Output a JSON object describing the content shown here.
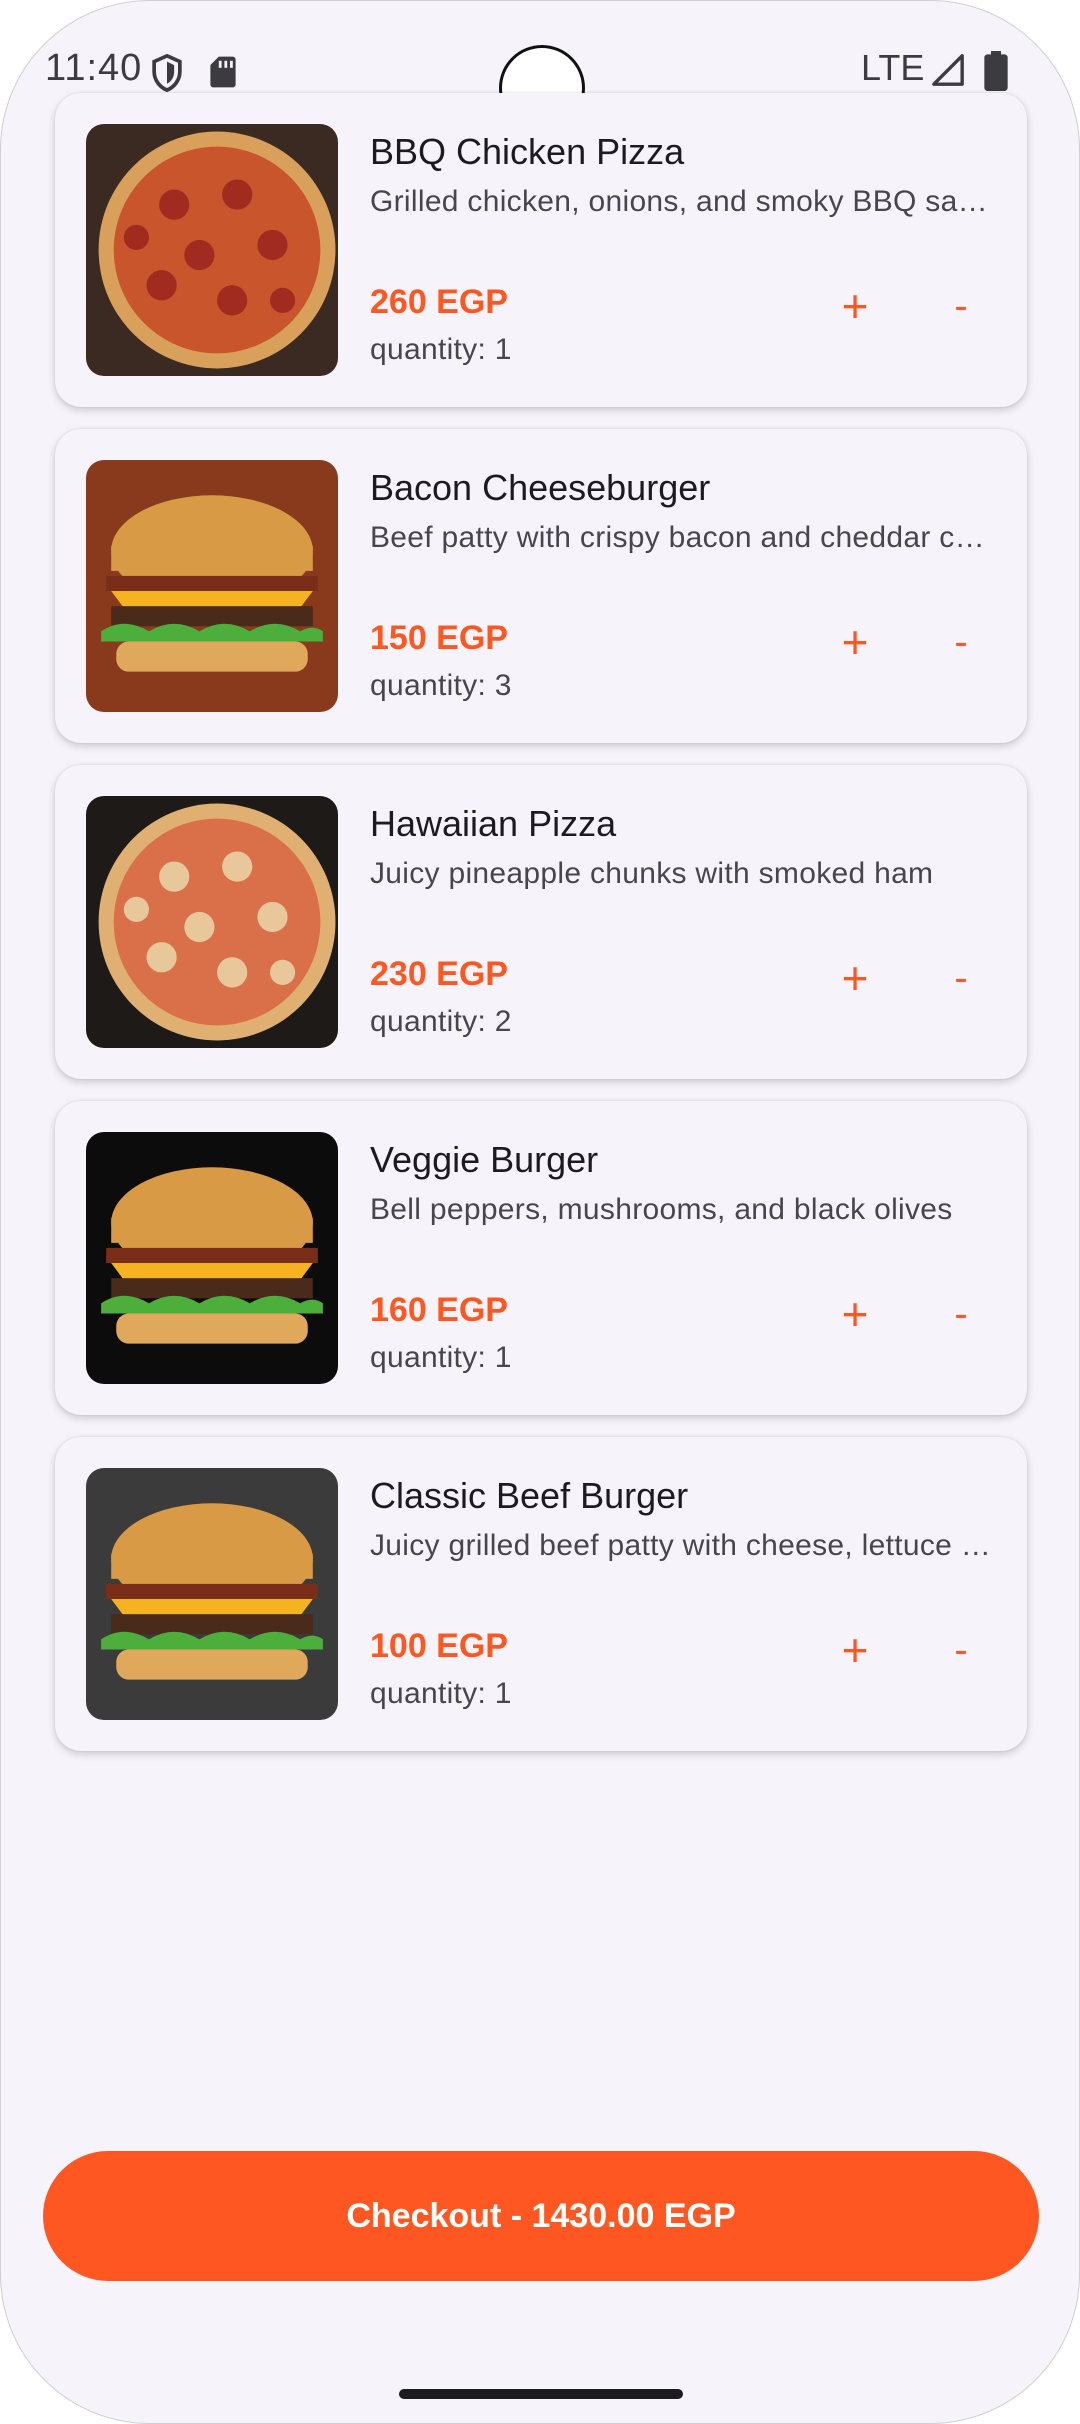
{
  "status_bar": {
    "time": "11:40",
    "network": "LTE",
    "icons": [
      "shield-icon",
      "sd-card-icon",
      "signal-icon",
      "battery-icon"
    ]
  },
  "cart": {
    "items": [
      {
        "name": "BBQ Chicken Pizza",
        "description": "Grilled chicken, onions, and smoky BBQ sauce",
        "price": "260 EGP",
        "quantity_text": "quantity: 1",
        "quantity": 1,
        "image": "pizza-photo"
      },
      {
        "name": "Bacon Cheeseburger",
        "description": "Beef patty with crispy bacon and cheddar cheese",
        "price": "150 EGP",
        "quantity_text": "quantity: 3",
        "quantity": 3,
        "image": "burger-photo"
      },
      {
        "name": "Hawaiian Pizza",
        "description": "Juicy pineapple chunks with smoked ham",
        "price": "230 EGP",
        "quantity_text": "quantity: 2",
        "quantity": 2,
        "image": "pizza-photo"
      },
      {
        "name": "Veggie Burger",
        "description": "Bell peppers, mushrooms, and black olives",
        "price": "160 EGP",
        "quantity_text": "quantity: 1",
        "quantity": 1,
        "image": "burger-photo"
      },
      {
        "name": "Classic Beef Burger",
        "description": "Juicy grilled beef patty with cheese, lettuce and tomato",
        "price": "100 EGP",
        "quantity_text": "quantity: 1",
        "quantity": 1,
        "image": "burger-photo"
      }
    ],
    "plus_label": "+",
    "minus_label": "-"
  },
  "checkout": {
    "label": "Checkout - 1430.00 EGP"
  },
  "colors": {
    "accent": "#ff5722",
    "background": "#f6f4fa",
    "text_primary": "#1c1b1f",
    "text_secondary": "#49454f"
  }
}
